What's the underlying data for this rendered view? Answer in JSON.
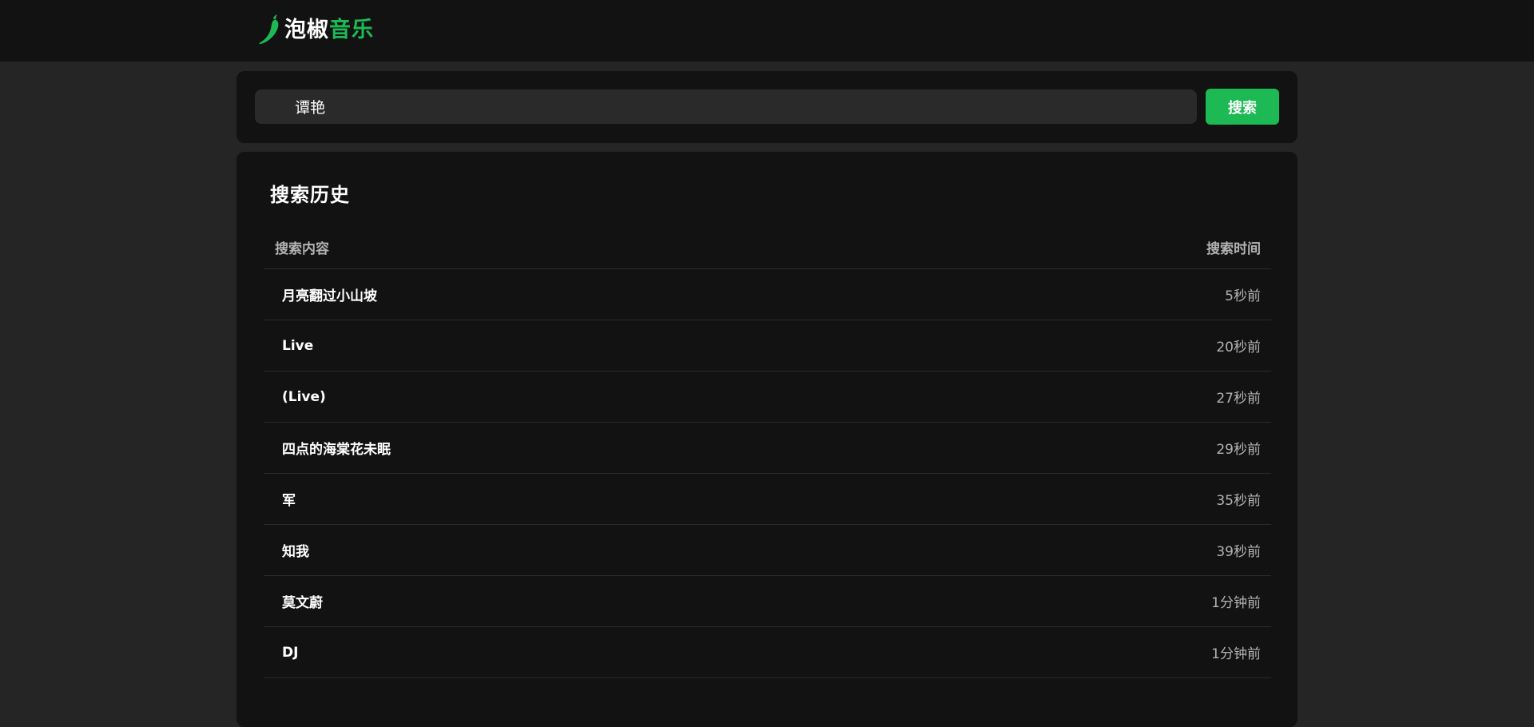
{
  "app": {
    "logo_text_white": "泡椒",
    "logo_text_green": "音乐",
    "accent_color": "#1db954"
  },
  "search": {
    "value": "谭艳",
    "button_label": "搜索"
  },
  "history": {
    "title": "搜索历史",
    "columns": {
      "query": "搜索内容",
      "time": "搜索时间"
    },
    "rows": [
      {
        "query": "月亮翻过小山坡",
        "time": "5秒前"
      },
      {
        "query": "Live",
        "time": "20秒前"
      },
      {
        "query": "(Live)",
        "time": "27秒前"
      },
      {
        "query": "四点的海棠花未眠",
        "time": "29秒前"
      },
      {
        "query": "军",
        "time": "35秒前"
      },
      {
        "query": "知我",
        "time": "39秒前"
      },
      {
        "query": "莫文蔚",
        "time": "1分钟前"
      },
      {
        "query": "DJ",
        "time": "1分钟前"
      }
    ]
  }
}
